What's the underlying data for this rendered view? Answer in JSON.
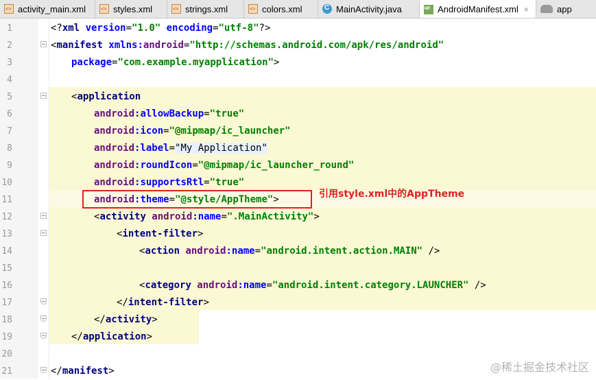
{
  "tabs": [
    {
      "label": "activity_main.xml",
      "icon": "xml-file-icon"
    },
    {
      "label": "styles.xml",
      "icon": "xml-file-icon"
    },
    {
      "label": "strings.xml",
      "icon": "xml-file-icon"
    },
    {
      "label": "colors.xml",
      "icon": "xml-file-icon"
    },
    {
      "label": "MainActivity.java",
      "icon": "java-class-icon"
    },
    {
      "label": "AndroidManifest.xml",
      "icon": "manifest-file-icon",
      "active": true,
      "close": "×"
    },
    {
      "label": "app",
      "icon": "android-module-icon"
    }
  ],
  "editor": {
    "line_numbers": [
      "1",
      "2",
      "3",
      "4",
      "5",
      "6",
      "7",
      "8",
      "9",
      "10",
      "11",
      "12",
      "13",
      "14",
      "15",
      "16",
      "17",
      "18",
      "19",
      "20",
      "21"
    ],
    "lines": {
      "l1": {
        "a": "<?",
        "b": "xml ",
        "c": "version",
        "d": "=",
        "e": "\"1.0\"",
        "f": " ",
        "g": "encoding",
        "h": "=",
        "i": "\"utf-8\"",
        "j": "?>"
      },
      "l2": {
        "a": "<",
        "b": "manifest ",
        "c": "xmlns:",
        "d": "android",
        "e": "=",
        "f": "\"http://schemas.android.com/apk/res/android\""
      },
      "l3": {
        "a": "package",
        "b": "=",
        "c": "\"com.example.myapplication\"",
        "d": ">"
      },
      "l5": {
        "a": "<",
        "b": "application"
      },
      "l6": {
        "a": "android",
        "b": ":allowBackup",
        "c": "=",
        "d": "\"true\""
      },
      "l7": {
        "a": "android",
        "b": ":icon",
        "c": "=",
        "d": "\"@mipmap/ic_launcher\""
      },
      "l8": {
        "a": "android",
        "b": ":label",
        "c": "=",
        "d": "\"My Application\""
      },
      "l9": {
        "a": "android",
        "b": ":roundIcon",
        "c": "=",
        "d": "\"@mipmap/ic_launcher_round\""
      },
      "l10": {
        "a": "android",
        "b": ":supportsRtl",
        "c": "=",
        "d": "\"true\""
      },
      "l11": {
        "a": "android",
        "b": ":theme",
        "c": "=",
        "d": "\"@style/AppTheme\"",
        "e": ">"
      },
      "l12": {
        "a": "<",
        "b": "activity ",
        "c": "android",
        "d": ":name",
        "e": "=",
        "f": "\".MainActivity\"",
        "g": ">"
      },
      "l13": {
        "a": "<",
        "b": "intent-filter",
        "c": ">"
      },
      "l14": {
        "a": "<",
        "b": "action ",
        "c": "android",
        "d": ":name",
        "e": "=",
        "f": "\"android.intent.action.MAIN\"",
        "g": " />"
      },
      "l16": {
        "a": "<",
        "b": "category ",
        "c": "android",
        "d": ":name",
        "e": "=",
        "f": "\"android.intent.category.LAUNCHER\"",
        "g": " />"
      },
      "l17": {
        "a": "</",
        "b": "intent-filter",
        "c": ">"
      },
      "l18": {
        "a": "</",
        "b": "activity",
        "c": ">"
      },
      "l19": {
        "a": "</",
        "b": "application",
        "c": ">"
      },
      "l21": {
        "a": "</",
        "b": "manifest",
        "c": ">"
      }
    }
  },
  "annotation": {
    "text": "引用style.xml中的AppTheme",
    "color": "#e02020"
  },
  "watermark": "@稀土掘金技术社区",
  "colors": {
    "tag": "#000080",
    "attribute": "#0000ff",
    "namespace": "#660e7a",
    "string": "#008000",
    "highlight": "#fbf8d4"
  }
}
